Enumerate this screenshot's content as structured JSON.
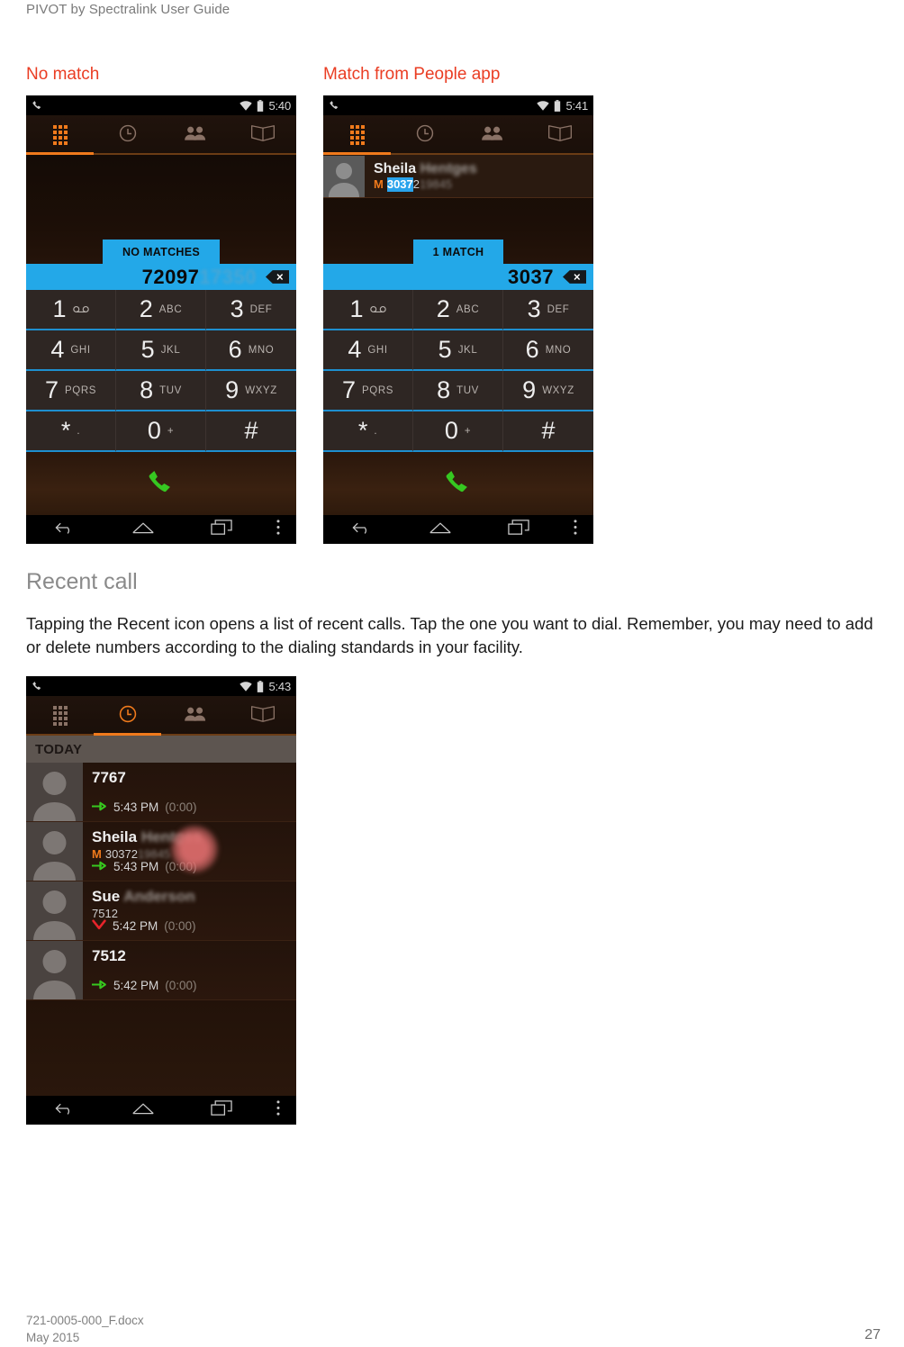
{
  "document": {
    "header": "PIVOT by Spectralink User Guide",
    "footer_file": "721-0005-000_F.docx",
    "footer_date": "May 2015",
    "page_number": "27"
  },
  "figures": {
    "caption_left": "No match",
    "caption_right": "Match from People app"
  },
  "section": {
    "heading": "Recent call",
    "body": "Tapping the Recent icon opens a list of recent calls. Tap the one you want to dial. Remember, you may need to add or delete numbers according to the dialing standards in your facility."
  },
  "phone_common": {
    "tabs": [
      {
        "name": "keypad-tab",
        "icon": "keypad-grid-icon",
        "active": true
      },
      {
        "name": "recents-tab",
        "icon": "clock-icon",
        "active": false
      },
      {
        "name": "contacts-tab",
        "icon": "people-icon",
        "active": false
      },
      {
        "name": "directory-tab",
        "icon": "open-book-icon",
        "active": false
      }
    ],
    "keypad": [
      {
        "digit": "1",
        "letters": "",
        "icon": "voicemail-icon"
      },
      {
        "digit": "2",
        "letters": "ABC"
      },
      {
        "digit": "3",
        "letters": "DEF"
      },
      {
        "digit": "4",
        "letters": "GHI"
      },
      {
        "digit": "5",
        "letters": "JKL"
      },
      {
        "digit": "6",
        "letters": "MNO"
      },
      {
        "digit": "7",
        "letters": "PQRS"
      },
      {
        "digit": "8",
        "letters": "TUV"
      },
      {
        "digit": "9",
        "letters": "WXYZ"
      },
      {
        "digit": "*",
        "letters": "."
      },
      {
        "digit": "0",
        "letters": "+"
      },
      {
        "digit": "#",
        "letters": ""
      }
    ],
    "nav": [
      "back-icon",
      "home-icon",
      "recent-apps-icon",
      "overflow-menu-icon"
    ],
    "accent_orange": "#f07a1c",
    "accent_blue": "#23a8e8",
    "call_green": "#36c721"
  },
  "phone1": {
    "status_time": "5:40",
    "match_badge": "NO MATCHES",
    "dialed_visible": "72097",
    "dialed_blurred": "17350"
  },
  "phone2": {
    "status_time": "5:41",
    "match_badge": "1 MATCH",
    "dialed_visible": "3037",
    "contact": {
      "first_name": "Sheila",
      "last_name_blurred": "Hentges",
      "number_label": "M",
      "number_highlight": "3037",
      "number_tail": "2",
      "number_blurred": "19845"
    }
  },
  "phone3": {
    "status_time": "5:43",
    "group_header": "TODAY",
    "calls": [
      {
        "name": "7767",
        "name_blurred": "",
        "sub": "",
        "direction": "outgoing",
        "time": "5:43 PM",
        "duration": "(0:00)"
      },
      {
        "name": "Sheila",
        "name_blurred": "Hentges",
        "sub_label": "M",
        "sub": "30372",
        "sub_blurred": "19845",
        "direction": "outgoing",
        "time": "5:43 PM",
        "duration": "(0:00)"
      },
      {
        "name": "Sue",
        "name_blurred": "Anderson",
        "sub": "7512",
        "direction": "missed",
        "time": "5:42 PM",
        "duration": "(0:00)"
      },
      {
        "name": "7512",
        "name_blurred": "",
        "sub": "",
        "direction": "outgoing",
        "time": "5:42 PM",
        "duration": "(0:00)"
      }
    ]
  }
}
